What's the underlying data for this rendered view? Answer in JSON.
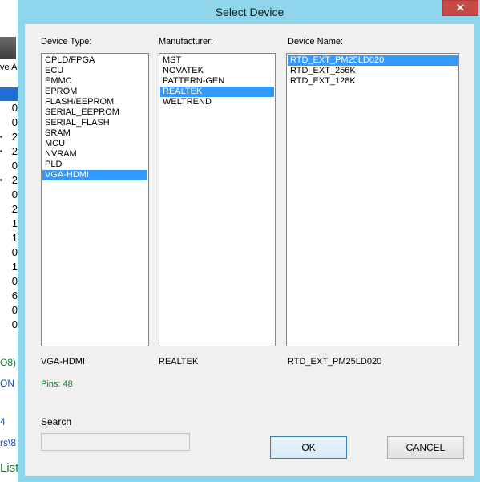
{
  "background_app": {
    "toolbar_label": "ve A",
    "list_values": [
      "0",
      "0",
      "2",
      "2",
      "0",
      "2",
      "0",
      "2",
      "1",
      "1",
      "0",
      "1",
      "0",
      "6",
      "0",
      "0"
    ],
    "status_lines": [
      "O8)",
      "ON",
      "4",
      "rs\\8",
      "List"
    ]
  },
  "dialog": {
    "title": "Select Device",
    "close_label": "✕",
    "device_type": {
      "label": "Device Type:",
      "items": [
        "CPLD/FPGA",
        "ECU",
        "EMMC",
        "EPROM",
        "FLASH/EEPROM",
        "SERIAL_EEPROM",
        "SERIAL_FLASH",
        "SRAM",
        "MCU",
        "NVRAM",
        "PLD",
        "VGA-HDMI"
      ],
      "selected": "VGA-HDMI"
    },
    "manufacturer": {
      "label": "Manufacturer:",
      "items": [
        "MST",
        "NOVATEK",
        "PATTERN-GEN",
        "REALTEK",
        "WELTREND"
      ],
      "selected": "REALTEK"
    },
    "device_name": {
      "label": "Device Name:",
      "items": [
        "RTD_EXT_PM25LD020",
        "RTD_EXT_256K",
        "RTD_EXT_128K"
      ],
      "selected": "RTD_EXT_PM25LD020"
    },
    "summary": {
      "device_type": "VGA-HDMI",
      "manufacturer": "REALTEK",
      "device_name": "RTD_EXT_PM25LD020",
      "pins": "Pins: 48"
    },
    "search": {
      "label": "Search",
      "value": "",
      "placeholder": ""
    },
    "buttons": {
      "ok": "OK",
      "cancel": "CANCEL"
    }
  },
  "colors": {
    "dialog_frame": "#8fd5ec",
    "dialog_body": "#f0f0f0",
    "selection": "#3399ff",
    "close_button": "#c74a47",
    "pins_text": "#117a2e"
  }
}
